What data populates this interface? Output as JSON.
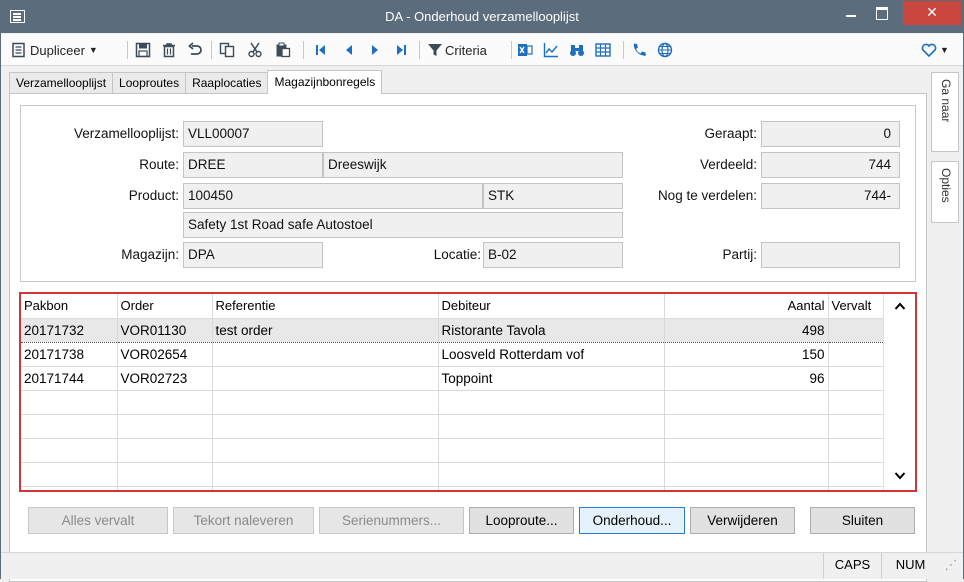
{
  "window": {
    "title": "DA - Onderhoud verzamellooplijst",
    "minimize": "",
    "maximize": "",
    "close": "✕"
  },
  "toolbar": {
    "duplicate_label": "Dupliceer",
    "criteria_label": "Criteria"
  },
  "tabs": [
    {
      "label": "Verzamellooplijst"
    },
    {
      "label": "Looproutes"
    },
    {
      "label": "Raaplocaties"
    },
    {
      "label": "Magazijnbonregels"
    }
  ],
  "side_tabs": {
    "goto": "Ga naar",
    "options": "Opties"
  },
  "form": {
    "verzamellooplijst": {
      "label": "Verzamellooplijst:",
      "value": "VLL00007"
    },
    "route": {
      "label": "Route:",
      "code": "DREE",
      "name": "Dreeswijk"
    },
    "product": {
      "label": "Product:",
      "code": "100450",
      "unit": "STK",
      "description": "Safety 1st Road safe Autostoel"
    },
    "magazijn": {
      "label": "Magazijn:",
      "value": "DPA"
    },
    "locatie": {
      "label": "Locatie:",
      "value": "B-02"
    },
    "geraapt": {
      "label": "Geraapt:",
      "value": "0"
    },
    "verdeeld": {
      "label": "Verdeeld:",
      "value": "744"
    },
    "nog_te_verdelen": {
      "label": "Nog te verdelen:",
      "value": "744-"
    },
    "partij": {
      "label": "Partij:",
      "value": ""
    }
  },
  "grid": {
    "columns": [
      "Pakbon",
      "Order",
      "Referentie",
      "Debiteur",
      "Aantal",
      "Vervalt"
    ],
    "rows": [
      {
        "pakbon": "20171732",
        "order": "VOR01130",
        "referentie": "test order",
        "debiteur": "Ristorante Tavola",
        "aantal": "498",
        "vervalt": ""
      },
      {
        "pakbon": "20171738",
        "order": "VOR02654",
        "referentie": "",
        "debiteur": "Loosveld Rotterdam vof",
        "aantal": "150",
        "vervalt": ""
      },
      {
        "pakbon": "20171744",
        "order": "VOR02723",
        "referentie": "",
        "debiteur": "Toppoint",
        "aantal": "96",
        "vervalt": ""
      }
    ]
  },
  "buttons": {
    "alles_vervalt": "Alles vervalt",
    "tekort_naleveren": "Tekort naleveren",
    "serienummers": "Serienummers...",
    "looproute": "Looproute...",
    "onderhoud": "Onderhoud...",
    "verwijderen": "Verwijderen",
    "sluiten": "Sluiten"
  },
  "status": {
    "caps": "CAPS",
    "num": "NUM"
  },
  "colors": {
    "titlebar": "#5b6c7d",
    "close": "#c9473f",
    "grid_border": "#d03636",
    "accent": "#1f6fc0"
  }
}
